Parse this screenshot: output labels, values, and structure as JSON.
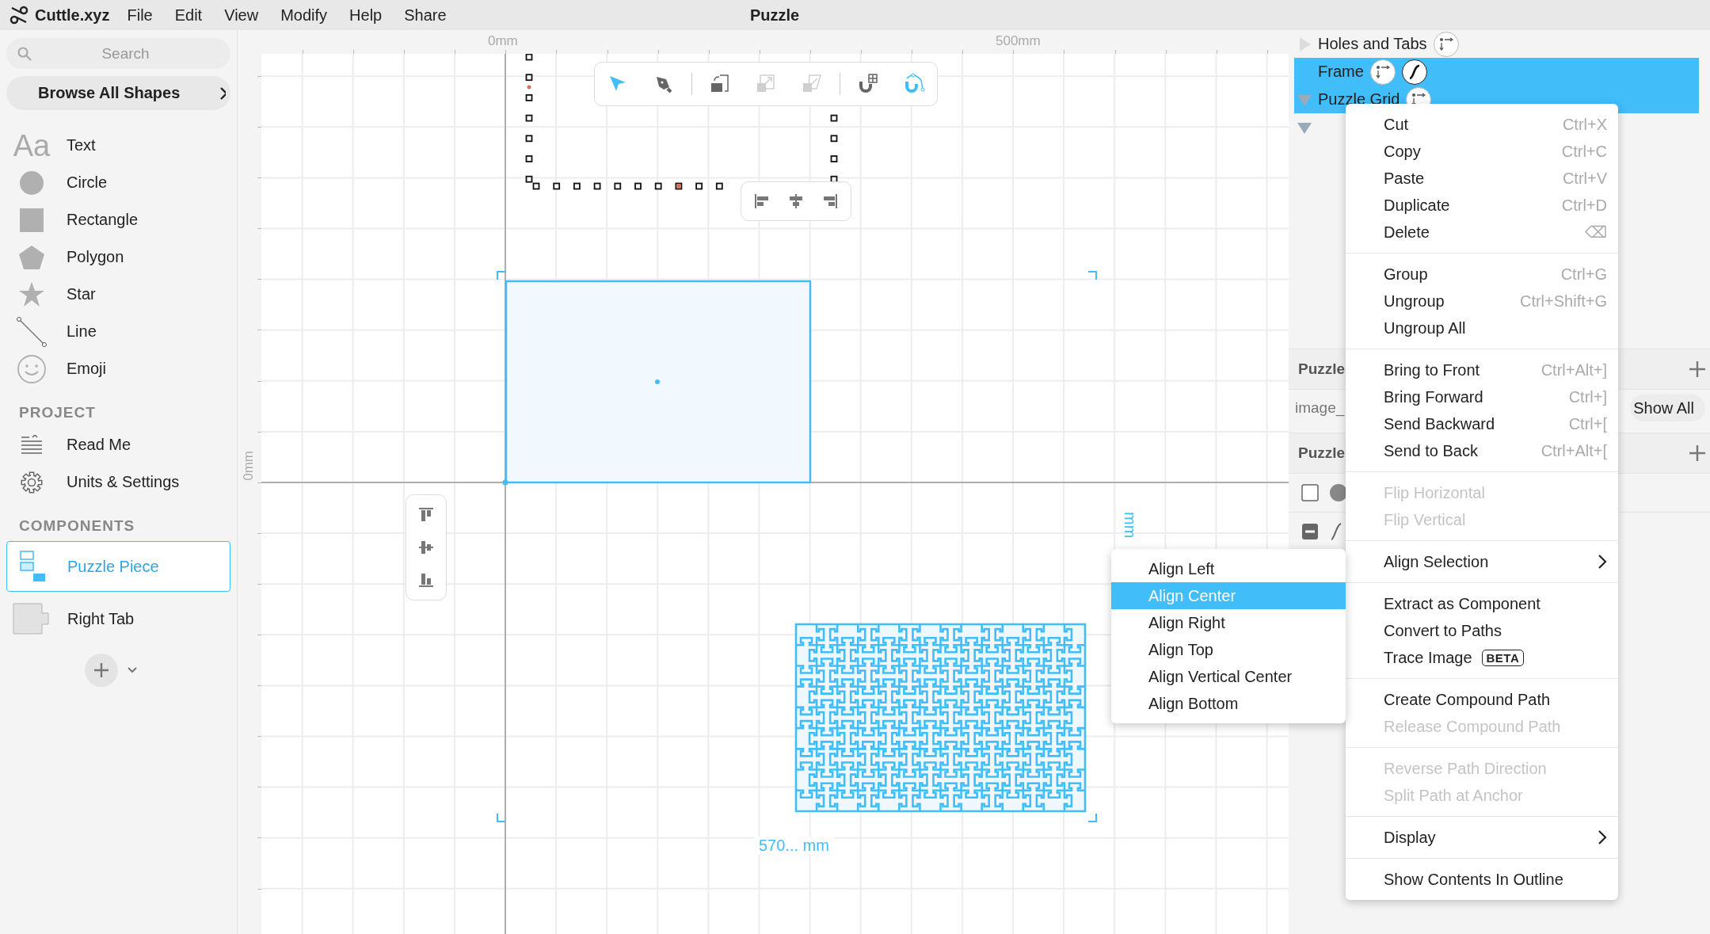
{
  "app": {
    "name": "Cuttle.xyz"
  },
  "menu": [
    "File",
    "Edit",
    "View",
    "Modify",
    "Help",
    "Share"
  ],
  "document_title": "Puzzle",
  "sidebar": {
    "search": {
      "placeholder": "Search"
    },
    "browse_button": "Browse All Shapes",
    "shapes": [
      {
        "kind": "text",
        "label": "Text",
        "icon_text": "Aa"
      },
      {
        "kind": "circle",
        "label": "Circle"
      },
      {
        "kind": "rectangle",
        "label": "Rectangle"
      },
      {
        "kind": "polygon",
        "label": "Polygon"
      },
      {
        "kind": "star",
        "label": "Star"
      },
      {
        "kind": "line",
        "label": "Line"
      },
      {
        "kind": "emoji",
        "label": "Emoji"
      }
    ],
    "project_heading": "PROJECT",
    "project_items": [
      {
        "kind": "readme",
        "label": "Read Me"
      },
      {
        "kind": "settings",
        "label": "Units & Settings"
      }
    ],
    "components_heading": "COMPONENTS",
    "components": [
      {
        "kind": "group",
        "label": "Puzzle Piece",
        "selected": true
      },
      {
        "kind": "tab",
        "label": "Right Tab",
        "selected": false
      }
    ]
  },
  "canvas": {
    "ruler_top": [
      "0mm",
      "500mm"
    ],
    "ruler_left": [
      "0mm"
    ],
    "toolbar": [
      [
        {
          "kind": "pointer",
          "active": true,
          "disabled": false
        },
        {
          "kind": "pen",
          "active": false,
          "disabled": false
        }
      ],
      [
        {
          "kind": "transform",
          "active": false,
          "disabled": false
        },
        {
          "kind": "scale",
          "active": false,
          "disabled": true
        },
        {
          "kind": "skew",
          "active": false,
          "disabled": true
        }
      ],
      [
        {
          "kind": "snap-grid",
          "active": false,
          "disabled": false
        },
        {
          "kind": "snap-curve",
          "active": true,
          "disabled": false
        }
      ]
    ],
    "align_horizontal": [
      {
        "kind": "left"
      },
      {
        "kind": "center"
      },
      {
        "kind": "right"
      }
    ],
    "align_vertical": [
      {
        "kind": "top"
      },
      {
        "kind": "middle"
      },
      {
        "kind": "bottom"
      }
    ],
    "width_label": "570... mm",
    "height_label": "mm"
  },
  "outline": {
    "items": [
      {
        "label": "Holes and Tabs",
        "selected": false,
        "expanded": false,
        "badges": [
          {
            "kind": "parameters"
          }
        ]
      },
      {
        "label": "Frame",
        "selected": true,
        "badges": [
          {
            "kind": "parameters"
          },
          {
            "kind": "path"
          }
        ]
      },
      {
        "label": "Puzzle Grid",
        "selected": true,
        "expanded": true,
        "badges": [
          {
            "kind": "parameters"
          }
        ],
        "children": [
          {
            "expanded": true,
            "selected": false
          }
        ]
      }
    ],
    "panel_rows": [
      {
        "kind": "section",
        "title": "Puzzle"
      },
      {
        "kind": "param",
        "label": "image_",
        "button": "Show All"
      },
      {
        "kind": "section",
        "title": "Puzzle"
      },
      {
        "kind": "fill",
        "mixed": false
      },
      {
        "kind": "stroke",
        "mixed": true
      }
    ]
  },
  "context_menu": {
    "groups": [
      [
        {
          "label": "Cut",
          "shortcut": "Ctrl+X",
          "disabled": false
        },
        {
          "label": "Copy",
          "shortcut": "Ctrl+C",
          "disabled": false
        },
        {
          "label": "Paste",
          "shortcut": "Ctrl+V",
          "disabled": false
        },
        {
          "label": "Duplicate",
          "shortcut": "Ctrl+D",
          "disabled": false
        },
        {
          "label": "Delete",
          "shortcut": "⌫",
          "disabled": false
        }
      ],
      [
        {
          "label": "Group",
          "shortcut": "Ctrl+G",
          "disabled": false
        },
        {
          "label": "Ungroup",
          "shortcut": "Ctrl+Shift+G",
          "disabled": false
        },
        {
          "label": "Ungroup All",
          "disabled": false
        }
      ],
      [
        {
          "label": "Bring to Front",
          "shortcut": "Ctrl+Alt+]",
          "disabled": false
        },
        {
          "label": "Bring Forward",
          "shortcut": "Ctrl+]",
          "disabled": false
        },
        {
          "label": "Send Backward",
          "shortcut": "Ctrl+[",
          "disabled": false
        },
        {
          "label": "Send to Back",
          "shortcut": "Ctrl+Alt+[",
          "disabled": false
        }
      ],
      [
        {
          "label": "Flip Horizontal",
          "disabled": true
        },
        {
          "label": "Flip Vertical",
          "disabled": true
        }
      ],
      [
        {
          "label": "Align Selection",
          "disabled": false,
          "has_submenu": true
        }
      ],
      [
        {
          "label": "Extract as Component",
          "disabled": false
        },
        {
          "label": "Convert to Paths",
          "disabled": false
        },
        {
          "label": "Trace Image",
          "badge": "BETA",
          "disabled": false
        }
      ],
      [
        {
          "label": "Create Compound Path",
          "disabled": false
        },
        {
          "label": "Release Compound Path",
          "disabled": true
        }
      ],
      [
        {
          "label": "Reverse Path Direction",
          "disabled": true
        },
        {
          "label": "Split Path at Anchor",
          "disabled": true
        }
      ],
      [
        {
          "label": "Display",
          "disabled": false,
          "has_submenu": true
        }
      ],
      [
        {
          "label": "Show Contents In Outline",
          "disabled": false
        }
      ]
    ]
  },
  "submenu": {
    "items": [
      {
        "label": "Align Left",
        "selected": false
      },
      {
        "label": "Align Center",
        "selected": true
      },
      {
        "label": "Align Right",
        "selected": false
      },
      {
        "label": "Align Top",
        "selected": false
      },
      {
        "label": "Align Vertical Center",
        "selected": false
      },
      {
        "label": "Align Bottom",
        "selected": false
      }
    ]
  }
}
